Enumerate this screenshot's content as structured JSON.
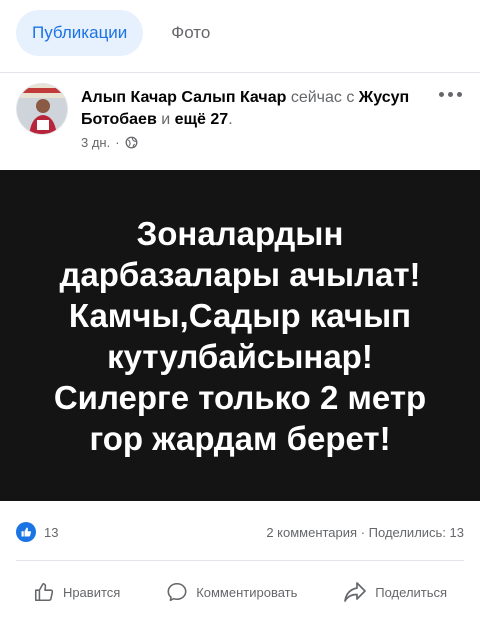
{
  "tabs": [
    {
      "label": "Публикации",
      "active": true
    },
    {
      "label": "Фото",
      "active": false
    }
  ],
  "post": {
    "author": "Алып Качар Салып Качар",
    "with_text": "сейчас с",
    "tagged": "Жусуп Ботобаев",
    "and_text": "и",
    "others": "ещё 27",
    "period": ".",
    "time": "3 дн.",
    "separator": "·",
    "privacy_icon": "globe-icon",
    "image_text": "Зоналардын\nдарбазалары ачылат!\nКамчы,Садыр качып\nкутулбайсынар!\nСилерге только 2 метр\nгор жардам берет!"
  },
  "stats": {
    "likes": "13",
    "comments": "2 комментария",
    "dot": "·",
    "shares": "Поделились: 13"
  },
  "actions": {
    "like": "Нравится",
    "comment": "Комментировать",
    "share": "Поделиться"
  },
  "colors": {
    "accent": "#1b74e4",
    "tab_active_bg": "#e7f0fd",
    "muted": "#65676b",
    "image_bg": "#141414"
  }
}
